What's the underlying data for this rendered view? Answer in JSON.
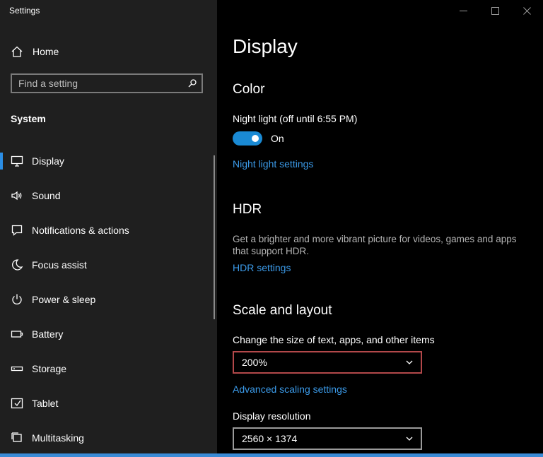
{
  "app": {
    "title": "Settings"
  },
  "sidebar": {
    "home_label": "Home",
    "search": {
      "placeholder": "Find a setting"
    },
    "section_heading": "System",
    "items": [
      {
        "label": "Display",
        "icon": "monitor-icon",
        "active": true
      },
      {
        "label": "Sound",
        "icon": "speaker-icon"
      },
      {
        "label": "Notifications & actions",
        "icon": "notification-icon"
      },
      {
        "label": "Focus assist",
        "icon": "moon-icon"
      },
      {
        "label": "Power & sleep",
        "icon": "power-icon"
      },
      {
        "label": "Battery",
        "icon": "battery-icon"
      },
      {
        "label": "Storage",
        "icon": "storage-icon"
      },
      {
        "label": "Tablet",
        "icon": "tablet-icon"
      },
      {
        "label": "Multitasking",
        "icon": "multitasking-icon"
      }
    ]
  },
  "main": {
    "page_title": "Display",
    "color": {
      "heading": "Color",
      "night_light_label": "Night light (off until 6:55 PM)",
      "toggle_state": "On",
      "night_light_link": "Night light settings"
    },
    "hdr": {
      "heading": "HDR",
      "description": "Get a brighter and more vibrant picture for videos, games and apps that support HDR.",
      "link": "HDR settings"
    },
    "scale": {
      "heading": "Scale and layout",
      "size_label": "Change the size of text, apps, and other items",
      "size_value": "200%",
      "advanced_link": "Advanced scaling settings",
      "resolution_label": "Display resolution",
      "resolution_value": "2560 × 1374"
    }
  },
  "colors": {
    "accent": "#1a8ad4",
    "link": "#3b9ae8",
    "focus_border": "#b3484a"
  }
}
